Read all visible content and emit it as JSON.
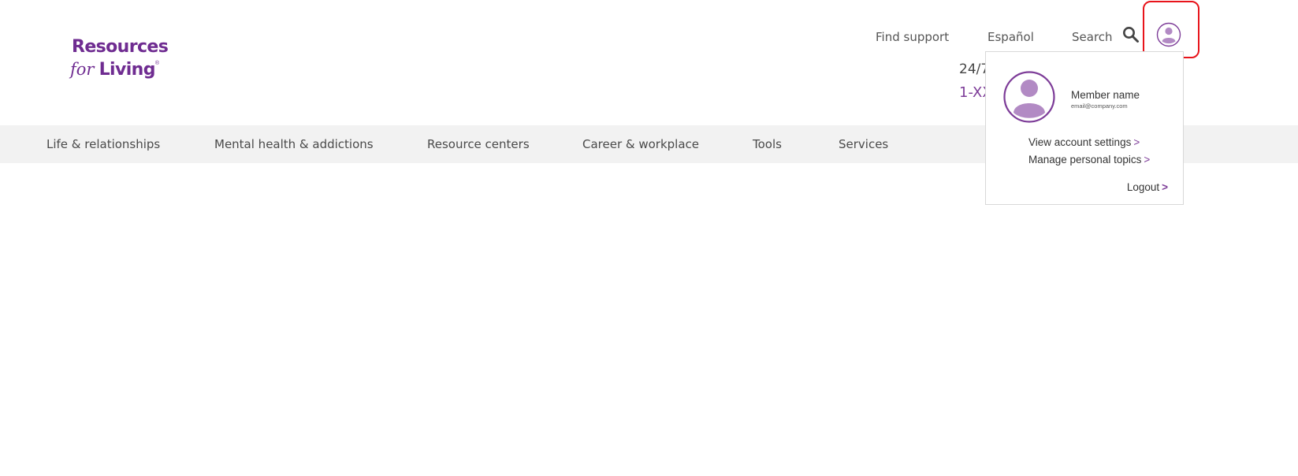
{
  "logo": {
    "line1": "Resources",
    "for_text": "for",
    "living_text": "Living",
    "reg_mark": "®"
  },
  "utility_nav": {
    "find_support": "Find support",
    "espanol": "Español",
    "search": "Search"
  },
  "contact": {
    "hours": "24/7",
    "phone": "1-XX"
  },
  "main_nav": {
    "items": [
      {
        "label": "Life & relationships"
      },
      {
        "label": "Mental health & addictions"
      },
      {
        "label": "Resource centers"
      },
      {
        "label": "Career & workplace"
      },
      {
        "label": "Tools"
      },
      {
        "label": "Services"
      }
    ]
  },
  "account_menu": {
    "member_name": "Member name",
    "email": "email@company.com",
    "view_settings": "View account settings",
    "manage_topics": "Manage personal topics",
    "logout": "Logout",
    "chevron": ">"
  },
  "colors": {
    "brand_purple": "#6f2c91",
    "avatar_purple": "#b28ac4",
    "highlight_red": "#e8141b",
    "nav_bg": "#f2f2f2"
  },
  "icons": {
    "search": "search-icon",
    "avatar": "user-avatar-icon"
  }
}
